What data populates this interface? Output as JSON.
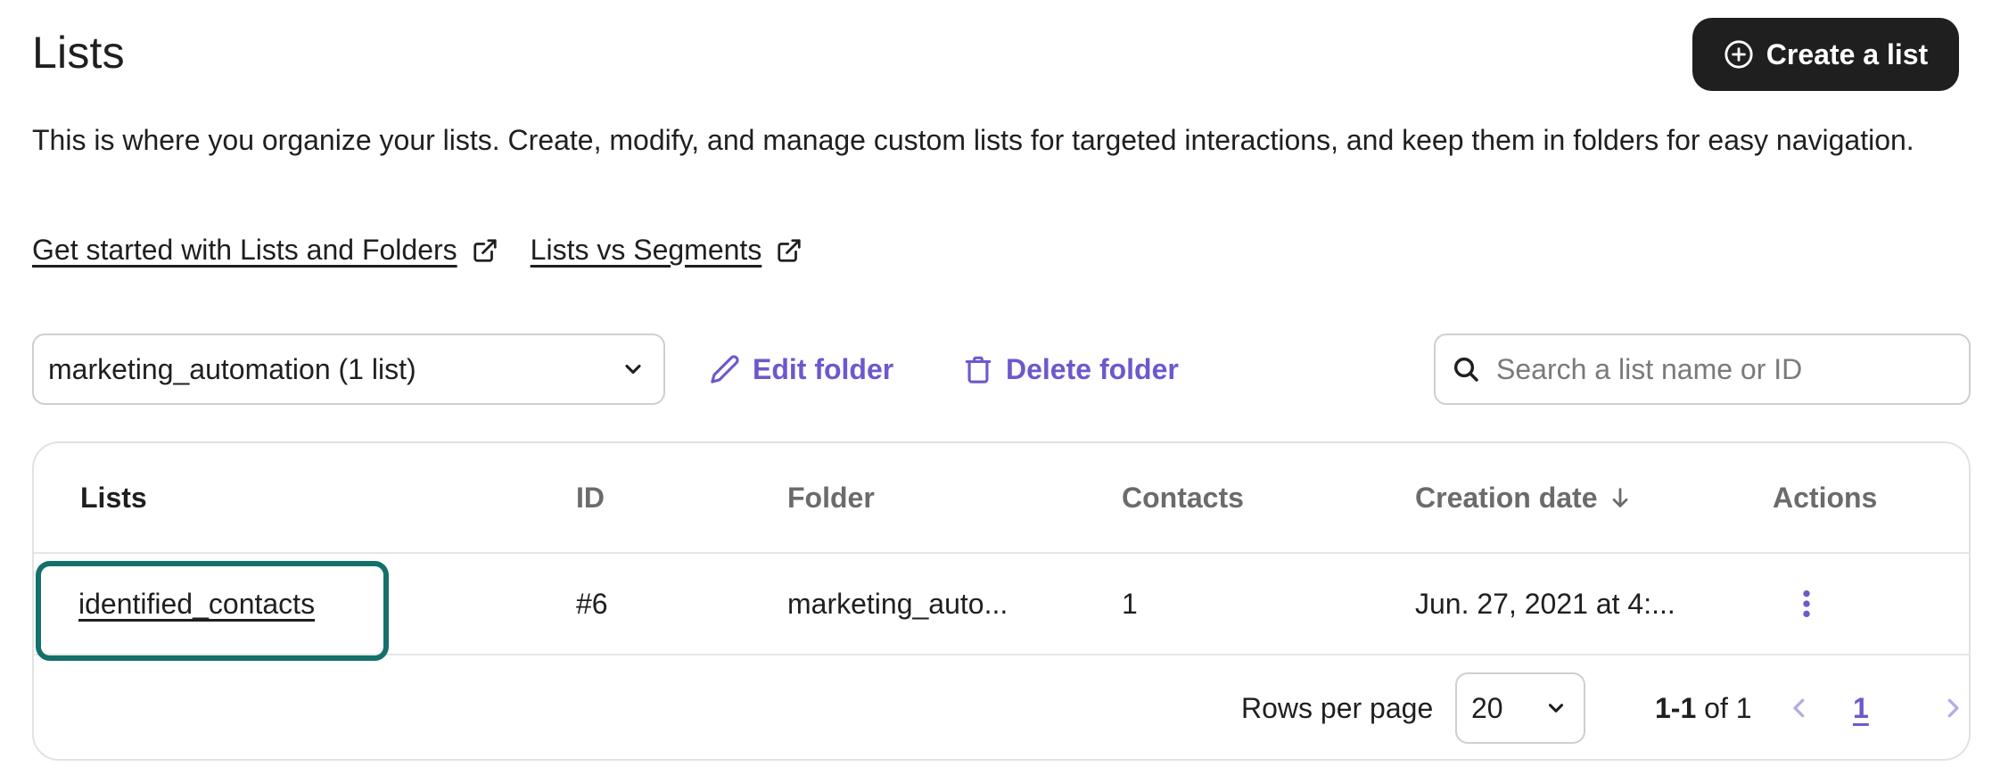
{
  "header": {
    "title": "Lists",
    "create_button_label": "Create a list",
    "description": "This is where you organize your lists. Create, modify, and manage custom lists for targeted interactions, and keep them in folders for easy navigation."
  },
  "help_links": [
    {
      "label": "Get started with Lists and Folders",
      "icon": "external-link-icon"
    },
    {
      "label": "Lists vs Segments",
      "icon": "external-link-icon"
    }
  ],
  "toolbar": {
    "folder_selected": "marketing_automation (1 list)",
    "edit_folder_label": "Edit folder",
    "delete_folder_label": "Delete folder",
    "search_placeholder": "Search a list name or ID"
  },
  "table": {
    "columns": [
      "Lists",
      "ID",
      "Folder",
      "Contacts",
      "Creation date",
      "Actions"
    ],
    "sort_column": "Creation date",
    "rows": [
      {
        "name": "identified_contacts",
        "id": "#6",
        "folder": "marketing_auto...",
        "contacts": "1",
        "creation_date": "Jun. 27, 2021 at 4:..."
      }
    ]
  },
  "pagination": {
    "rows_per_page_label": "Rows per page",
    "rows_per_page_value": "20",
    "range_bold": "1-1",
    "range_rest": " of 1",
    "current_page": "1"
  },
  "colors": {
    "accent": "#6a5acd",
    "primary_button": "#1f1f1f",
    "focus_ring": "#14706a"
  }
}
